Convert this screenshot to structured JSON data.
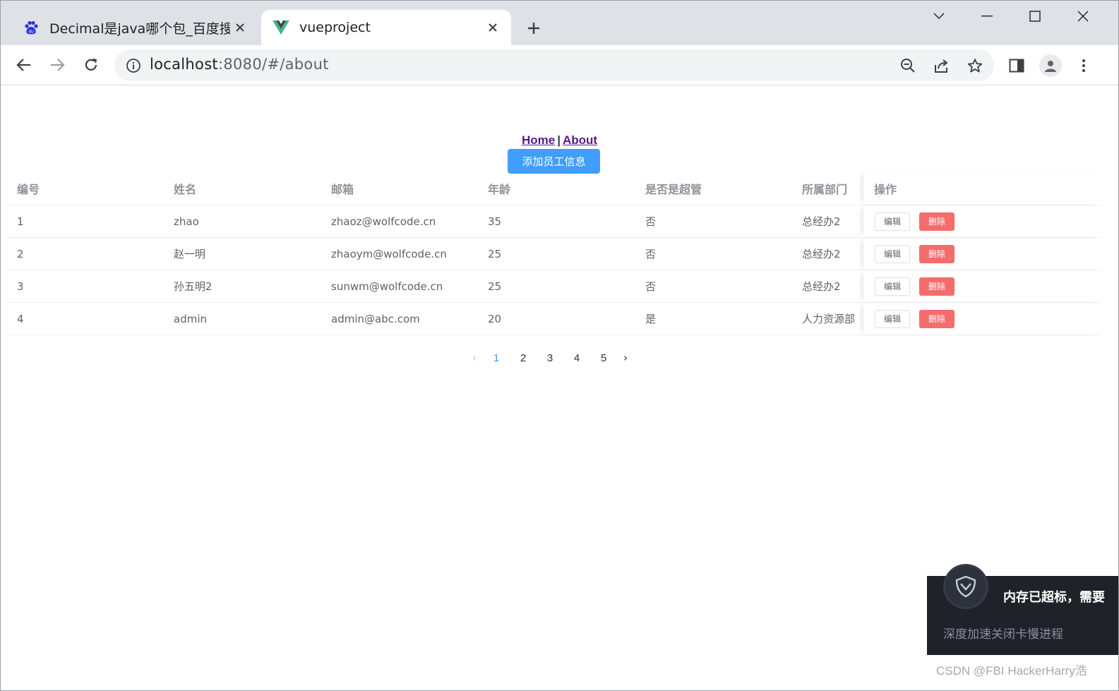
{
  "browser": {
    "tabs": [
      {
        "title": "Decimal是java哪个包_百度搜索",
        "icon": "baidu-paw-icon"
      },
      {
        "title": "vueproject",
        "icon": "vue-logo-icon"
      }
    ],
    "url_host": "localhost",
    "url_rest": ":8080/#/about"
  },
  "page": {
    "nav": {
      "home": "Home",
      "separator": "|",
      "about": "About"
    },
    "add_button": "添加员工信息",
    "table": {
      "headers": [
        "编号",
        "姓名",
        "邮箱",
        "年龄",
        "是否是超管",
        "所属部门",
        "操作"
      ],
      "rows": [
        [
          "1",
          "zhao",
          "zhaoz@wolfcode.cn",
          "35",
          "否",
          "总经办2"
        ],
        [
          "2",
          "赵一明",
          "zhaoym@wolfcode.cn",
          "25",
          "否",
          "总经办2"
        ],
        [
          "3",
          "孙五明2",
          "sunwm@wolfcode.cn",
          "25",
          "否",
          "总经办2"
        ],
        [
          "4",
          "admin",
          "admin@abc.com",
          "20",
          "是",
          "人力资源部"
        ]
      ],
      "edit_label": "编辑",
      "delete_label": "删除"
    },
    "pagination": {
      "pages": [
        "1",
        "2",
        "3",
        "4",
        "5"
      ],
      "current": "1",
      "prev": "‹",
      "next": "›"
    }
  },
  "toast": {
    "title": "内存已超标，需要",
    "message": "深度加速关闭卡慢进程"
  },
  "watermark": "CSDN @FBI HackerHarry浩",
  "colors": {
    "primary": "#409eff",
    "danger": "#f56c6c",
    "chrome_bg": "#dee1e6"
  }
}
